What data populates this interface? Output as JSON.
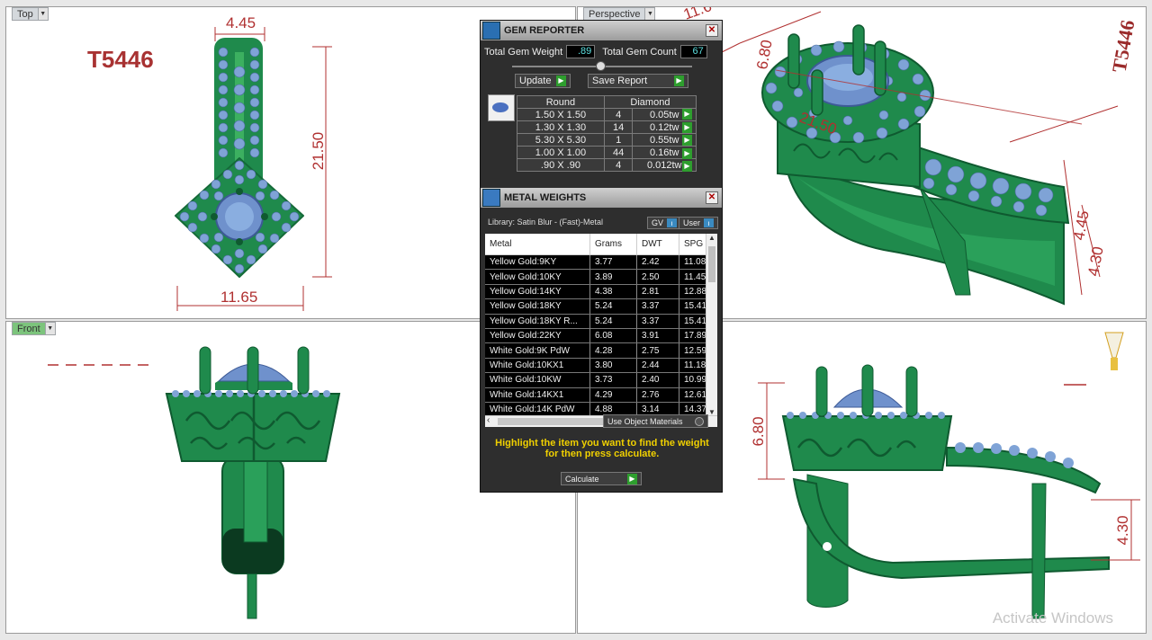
{
  "viewports": {
    "top": {
      "label": "Top",
      "dims": {
        "width_top": "4.45",
        "height": "21.50",
        "width_bottom": "11.65"
      },
      "model_code": "T5446"
    },
    "perspective": {
      "label": "Perspective",
      "dims": {
        "d1": "6.80",
        "d2": "21.50",
        "d3": "4.45",
        "d4": "4.30",
        "d5": "11.6"
      },
      "stamp": "T5446"
    },
    "front": {
      "label": "Front"
    },
    "side": {
      "dims": {
        "height": "6.80",
        "shank": "4.30"
      }
    }
  },
  "gem_reporter": {
    "title": "GEM REPORTER",
    "total_weight_label": "Total Gem Weight",
    "total_weight_value": ".89",
    "total_count_label": "Total Gem Count",
    "total_count_value": "67",
    "update_label": "Update",
    "save_label": "Save Report",
    "table_headers": [
      "Round",
      "Diamond"
    ],
    "rows": [
      {
        "size": "1.50 X 1.50",
        "count": "4",
        "weight": "0.05tw"
      },
      {
        "size": "1.30 X 1.30",
        "count": "14",
        "weight": "0.12tw"
      },
      {
        "size": "5.30 X 5.30",
        "count": "1",
        "weight": "0.55tw"
      },
      {
        "size": "1.00 X 1.00",
        "count": "44",
        "weight": "0.16tw"
      },
      {
        "size": ".90 X .90",
        "count": "4",
        "weight": "0.012tw"
      }
    ]
  },
  "metal_weights": {
    "title": "METAL WEIGHTS",
    "library": "Library: Satin Blur - (Fast)-Metal",
    "gv_label": "GV",
    "user_label": "User",
    "columns": [
      "Metal",
      "Grams",
      "DWT",
      "SPG"
    ],
    "rows": [
      [
        "Yellow Gold:9KY",
        "3.77",
        "2.42",
        "11.08"
      ],
      [
        "Yellow Gold:10KY",
        "3.89",
        "2.50",
        "11.45"
      ],
      [
        "Yellow Gold:14KY",
        "4.38",
        "2.81",
        "12.88"
      ],
      [
        "Yellow Gold:18KY",
        "5.24",
        "3.37",
        "15.41"
      ],
      [
        "Yellow Gold:18KY R...",
        "5.24",
        "3.37",
        "15.41"
      ],
      [
        "Yellow Gold:22KY",
        "6.08",
        "3.91",
        "17.89"
      ],
      [
        "White Gold:9K PdW",
        "4.28",
        "2.75",
        "12.59"
      ],
      [
        "White Gold:10KX1",
        "3.80",
        "2.44",
        "11.18"
      ],
      [
        "White Gold:10KW",
        "3.73",
        "2.40",
        "10.99"
      ],
      [
        "White Gold:14KX1",
        "4.29",
        "2.76",
        "12.61"
      ],
      [
        "White Gold:14K PdW",
        "4.88",
        "3.14",
        "14.37"
      ]
    ],
    "use_object_materials": "Use Object Materials",
    "hint": "Highlight the item you want to find the weight for then press calculate.",
    "calculate_label": "Calculate"
  },
  "watermark": "Activate Windows",
  "colors": {
    "metal": "#1f8a4c",
    "gem": "#7fa3d6",
    "dimension": "#b03030",
    "panel_bg": "#2e2e2e"
  }
}
